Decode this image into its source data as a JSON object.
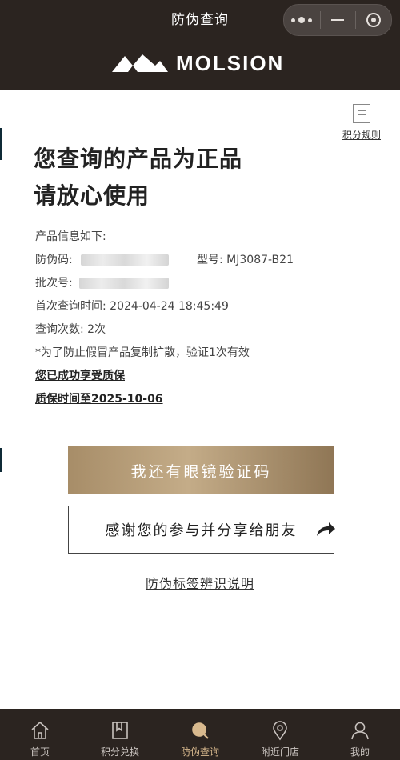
{
  "header": {
    "title": "防伪查询",
    "brand": "MOLSION"
  },
  "rules": {
    "label": "积分规则"
  },
  "headline": {
    "line1": "您查询的产品为正品",
    "line2": "请放心使用"
  },
  "info": {
    "intro": "产品信息如下:",
    "code_label": "防伪码:",
    "model_label": "型号:",
    "model_value": "MJ3087-B21",
    "batch_label": "批次号:",
    "first_query_label": "首次查询时间:",
    "first_query_value": "2024-04-24 18:45:49",
    "count_label": "查询次数:",
    "count_value": "2次",
    "note": "*为了防止假冒产品复制扩散，验证1次有效",
    "warranty_enjoyed": "您已成功享受质保",
    "warranty_until": "质保时间至2025-10-06"
  },
  "actions": {
    "verify_code": "我还有眼镜验证码",
    "share": "感谢您的参与并分享给朋友",
    "label_explain": "防伪标签辨识说明"
  },
  "tabs": [
    {
      "label": "首页",
      "icon": "home-icon"
    },
    {
      "label": "积分兑换",
      "icon": "bookmark-icon"
    },
    {
      "label": "防伪查询",
      "icon": "search-icon",
      "active": true
    },
    {
      "label": "附近门店",
      "icon": "location-pin-icon"
    },
    {
      "label": "我的",
      "icon": "user-icon"
    }
  ],
  "colors": {
    "header_bg": "#2b2420",
    "gold": "#b29a75",
    "active_tab": "#d8b98e"
  }
}
